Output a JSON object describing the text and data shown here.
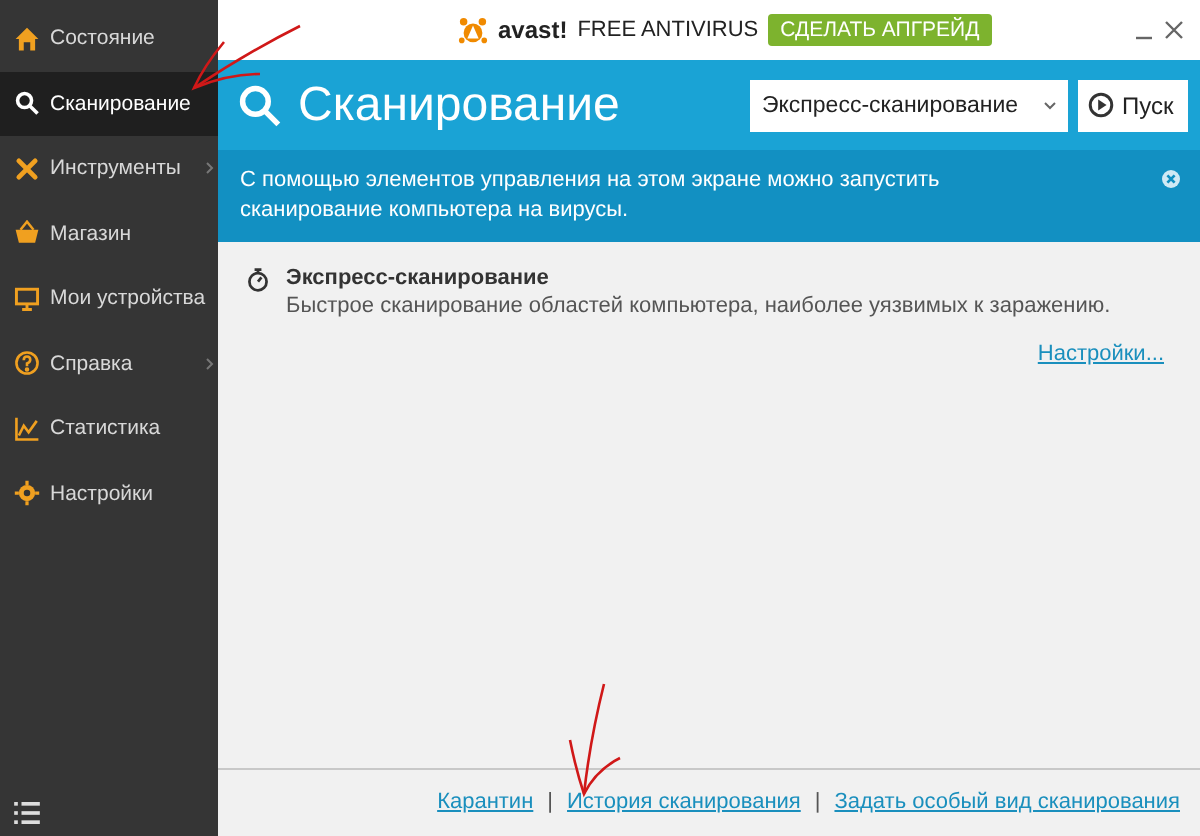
{
  "sidebar": {
    "items": [
      {
        "label": "Состояние",
        "kind": "home",
        "selected": false,
        "has_submenu": false
      },
      {
        "label": "Сканирование",
        "kind": "search",
        "selected": true,
        "has_submenu": false
      },
      {
        "label": "Инструменты",
        "kind": "tools",
        "selected": false,
        "has_submenu": true
      },
      {
        "label": "Магазин",
        "kind": "basket",
        "selected": false,
        "has_submenu": false
      },
      {
        "label": "Мои устройства",
        "kind": "monitor",
        "selected": false,
        "has_submenu": false
      },
      {
        "label": "Справка",
        "kind": "help",
        "selected": false,
        "has_submenu": true
      },
      {
        "label": "Статистика",
        "kind": "chart",
        "selected": false,
        "has_submenu": false
      },
      {
        "label": "Настройки",
        "kind": "gear",
        "selected": false,
        "has_submenu": false
      }
    ]
  },
  "titlebar": {
    "logo": "avast!",
    "product": "FREE ANTIVIRUS",
    "upgrade_button": "СДЕЛАТЬ АПГРЕЙД"
  },
  "header": {
    "title": "Сканирование",
    "scan_type": "Экспресс-сканирование",
    "start_button": "Пуск"
  },
  "info": {
    "text": "С помощью элементов управления на этом экране можно запустить сканирование компьютера на вирусы."
  },
  "scan": {
    "title": "Экспресс-сканирование",
    "description": "Быстрое сканирование областей компьютера, наиболее уязвимых к заражению.",
    "settings_link": "Настройки..."
  },
  "footer": {
    "links": [
      "Карантин",
      "История сканирования",
      "Задать особый вид сканирования"
    ],
    "separator": "|"
  }
}
